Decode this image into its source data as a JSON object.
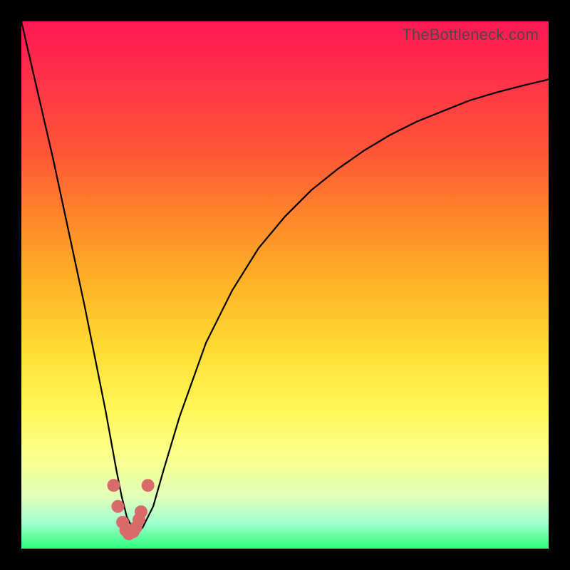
{
  "watermark": "TheBottleneck.com",
  "chart_data": {
    "type": "line",
    "title": "",
    "xlabel": "",
    "ylabel": "",
    "xlim": [
      0,
      100
    ],
    "ylim": [
      0,
      100
    ],
    "series": [
      {
        "name": "bottleneck-curve",
        "x": [
          0,
          3,
          6,
          9,
          12,
          14,
          16,
          18,
          19,
          20,
          21,
          22,
          23,
          25,
          27,
          30,
          35,
          40,
          45,
          50,
          55,
          60,
          65,
          70,
          75,
          80,
          85,
          90,
          95,
          100
        ],
        "values": [
          100,
          87,
          74,
          60,
          46,
          36,
          26,
          15,
          10,
          6,
          4,
          3,
          4,
          8,
          15,
          25,
          39,
          49,
          57,
          63,
          68,
          72,
          75.5,
          78.5,
          81,
          83,
          85,
          86.5,
          87.8,
          89
        ]
      }
    ],
    "markers": {
      "name": "highlight-points",
      "color": "#d96a6a",
      "x": [
        17.5,
        18.3,
        19.2,
        19.8,
        20.4,
        21.2,
        21.7,
        22.3,
        22.7,
        24.0
      ],
      "values": [
        12.0,
        8.0,
        5.0,
        3.5,
        2.8,
        3.2,
        4.0,
        5.5,
        7.0,
        12.0
      ]
    }
  }
}
